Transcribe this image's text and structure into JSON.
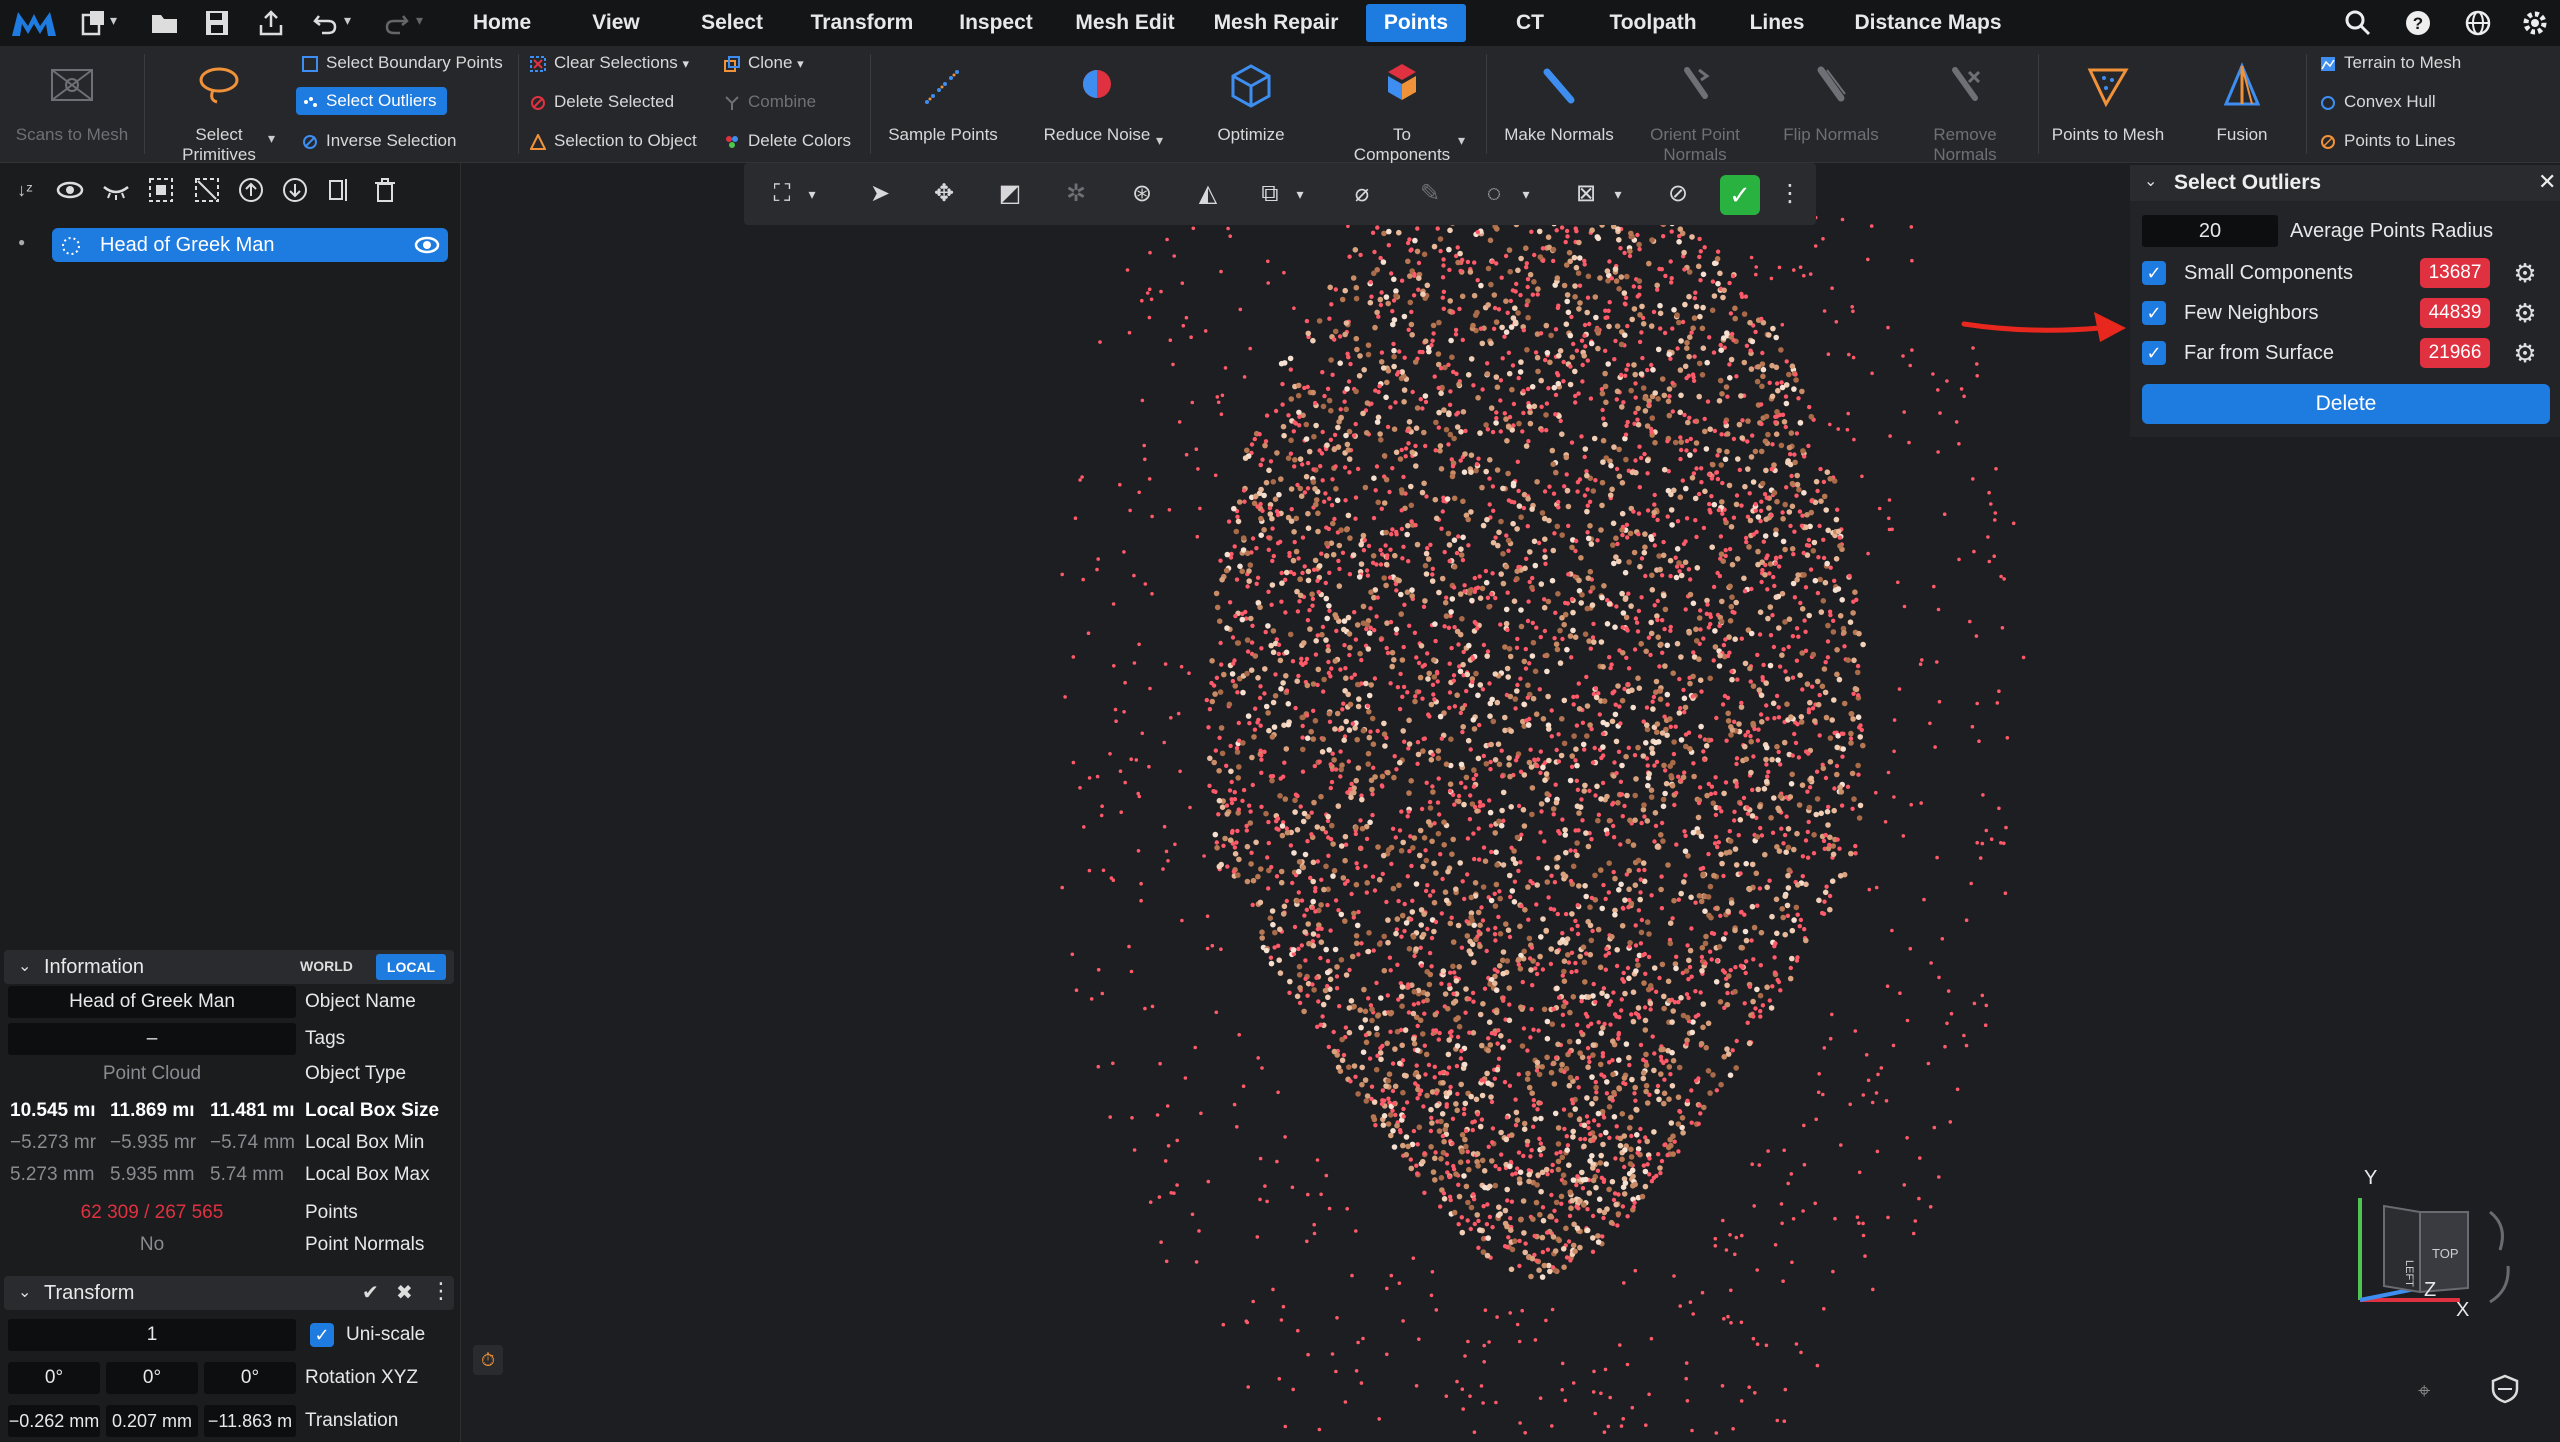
{
  "menubar": {
    "tabs": [
      "Home",
      "View",
      "Select",
      "Transform",
      "Inspect",
      "Mesh Edit",
      "Mesh Repair",
      "Points",
      "CT",
      "Toolpath",
      "Lines",
      "Distance Maps"
    ],
    "active_tab": "Points"
  },
  "ribbon": {
    "scans_to_mesh": "Scans to Mesh",
    "select_primitives": "Select\nPrimitives",
    "select_boundary_points": "Select Boundary Points",
    "select_outliers": "Select Outliers",
    "inverse_selection": "Inverse Selection",
    "clear_selections": "Clear Selections",
    "delete_selected": "Delete Selected",
    "selection_to_object": "Selection to Object",
    "clone": "Clone",
    "combine": "Combine",
    "delete_colors": "Delete Colors",
    "sample_points": "Sample Points",
    "reduce_noise": "Reduce Noise",
    "optimize": "Optimize",
    "to_components": "To\nComponents",
    "make_normals": "Make Normals",
    "orient_point_normals": "Orient Point\nNormals",
    "flip_normals": "Flip Normals",
    "remove_normals": "Remove\nNormals",
    "points_to_mesh": "Points to Mesh",
    "fusion": "Fusion",
    "terrain_to_mesh": "Terrain to Mesh",
    "convex_hull": "Convex Hull",
    "points_to_lines": "Points to Lines"
  },
  "scene_tree": {
    "item_name": "Head of Greek Man"
  },
  "information": {
    "title": "Information",
    "world": "WORLD",
    "local": "LOCAL",
    "object_name_value": "Head of Greek Man",
    "object_name_label": "Object Name",
    "tags_value": "–",
    "tags_label": "Tags",
    "object_type_value": "Point Cloud",
    "object_type_label": "Object Type",
    "box_size": [
      "10.545 mı",
      "11.869 mı",
      "11.481 mı"
    ],
    "box_size_label": "Local Box Size",
    "box_min": [
      "−5.273 mr",
      "−5.935 mr",
      "−5.74 mm"
    ],
    "box_min_label": "Local Box Min",
    "box_max": [
      "5.273 mm",
      "5.935 mm",
      "5.74 mm"
    ],
    "box_max_label": "Local Box Max",
    "points_value": "62 309 / 267 565",
    "points_label": "Points",
    "normals_value": "No",
    "normals_label": "Point Normals"
  },
  "transform": {
    "title": "Transform",
    "scale_value": "1",
    "uniscale_label": "Uni-scale",
    "rotation": [
      "0°",
      "0°",
      "0°"
    ],
    "rotation_label": "Rotation XYZ",
    "translation": [
      "−0.262 mm",
      "0.207 mm",
      "−11.863 m"
    ],
    "translation_label": "Translation"
  },
  "outliers": {
    "title": "Select Outliers",
    "radius_value": "20",
    "radius_label": "Average Points Radius",
    "rows": [
      {
        "label": "Small Components",
        "count": "13687"
      },
      {
        "label": "Few Neighbors",
        "count": "44839"
      },
      {
        "label": "Far from Surface",
        "count": "21966"
      }
    ],
    "delete_label": "Delete"
  },
  "view_cube": {
    "axis_y": "Y",
    "axis_z": "Z",
    "axis_x": "X",
    "face_top": "TOP",
    "face_left": "LEFT"
  },
  "colors": {
    "accent": "#1e7be0",
    "badge_red": "#e03140",
    "arrow_red": "#e8281e",
    "points_red": "#ff5a6a"
  }
}
